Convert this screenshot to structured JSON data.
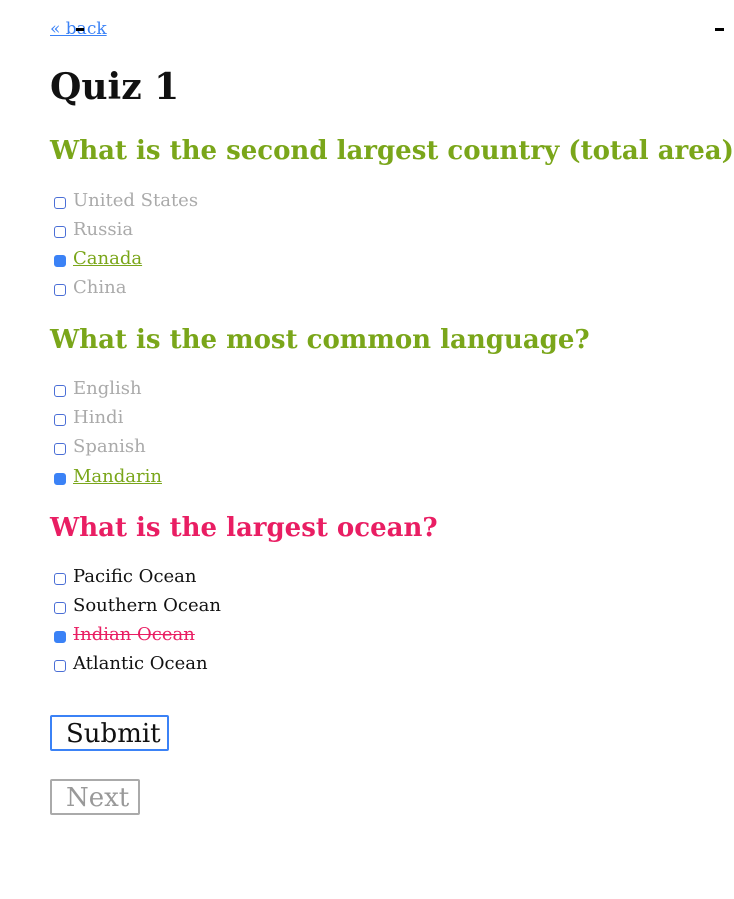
{
  "nav": {
    "back_label": "« back"
  },
  "quiz": {
    "title": "Quiz 1",
    "questions": [
      {
        "text": "What is the second largest country (total area)?",
        "status": "correct",
        "options": [
          {
            "label": "United States",
            "selected": false
          },
          {
            "label": "Russia",
            "selected": false
          },
          {
            "label": "Canada",
            "selected": true
          },
          {
            "label": "China",
            "selected": false
          }
        ]
      },
      {
        "text": "What is the most common language?",
        "status": "correct",
        "options": [
          {
            "label": "English",
            "selected": false
          },
          {
            "label": "Hindi",
            "selected": false
          },
          {
            "label": "Spanish",
            "selected": false
          },
          {
            "label": "Mandarin",
            "selected": true
          }
        ]
      },
      {
        "text": "What is the largest ocean?",
        "status": "wrong",
        "options": [
          {
            "label": "Pacific Ocean",
            "selected": false
          },
          {
            "label": "Southern Ocean",
            "selected": false
          },
          {
            "label": "Indian Ocean",
            "selected": true
          },
          {
            "label": "Atlantic Ocean",
            "selected": false
          }
        ]
      }
    ]
  },
  "actions": {
    "submit_label": "Submit",
    "next_label": "Next"
  },
  "colors": {
    "correct": "#7aa61a",
    "wrong": "#e91e63",
    "accent": "#3b82f6",
    "muted": "#aaaaaa"
  }
}
